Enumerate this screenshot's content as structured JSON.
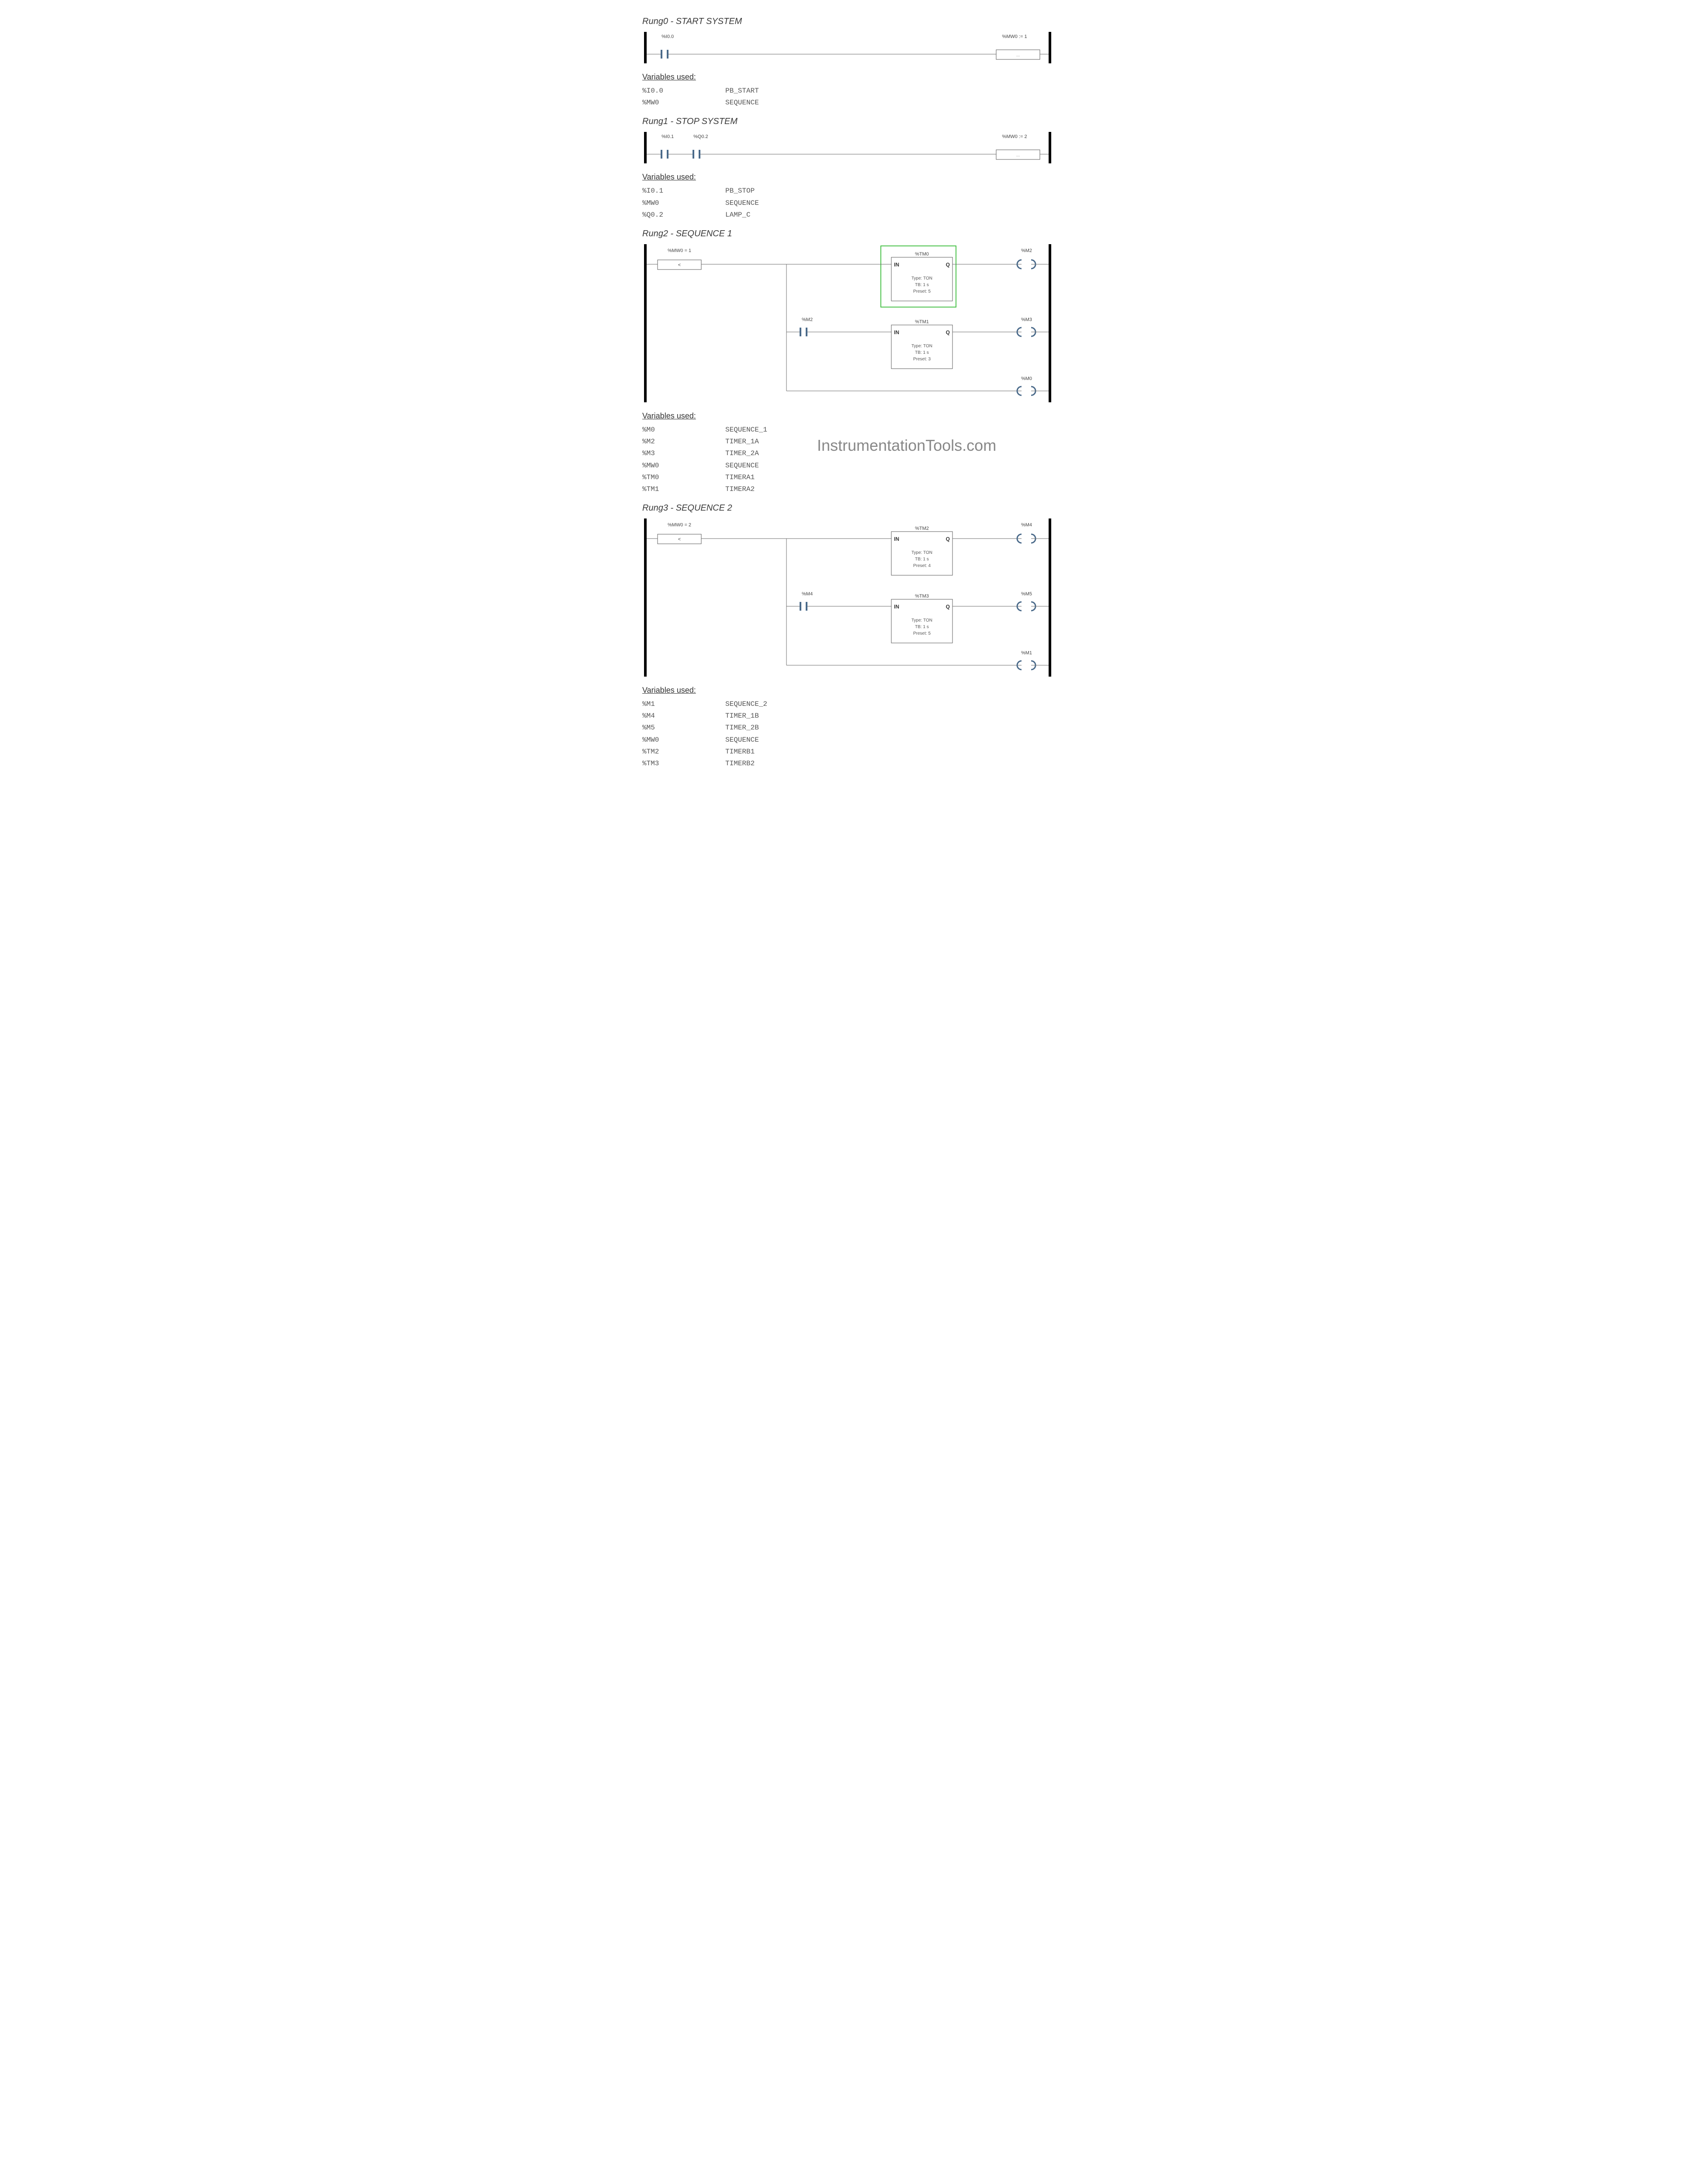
{
  "rungs": [
    {
      "title": "Rung0 - START SYSTEM",
      "contact1_label": "%I0.0",
      "op_label": "%MW0 := 1",
      "op_symbol": "...",
      "vars": [
        {
          "addr": "%I0.0",
          "name": "PB_START"
        },
        {
          "addr": "%MW0",
          "name": "SEQUENCE"
        }
      ]
    },
    {
      "title": "Rung1 - STOP SYSTEM",
      "contact1_label": "%I0.1",
      "contact2_label": "%Q0.2",
      "op_label": "%MW0 := 2",
      "op_symbol": "...",
      "vars": [
        {
          "addr": "%I0.1",
          "name": "PB_STOP"
        },
        {
          "addr": "%MW0",
          "name": "SEQUENCE"
        },
        {
          "addr": "%Q0.2",
          "name": "LAMP_C"
        }
      ]
    },
    {
      "title": "Rung2 - SEQUENCE 1",
      "compare_label": "%MW0 = 1",
      "compare_symbol": "<",
      "timer1": {
        "addr": "%TM0",
        "type": "Type: TON",
        "tb": "TB: 1 s",
        "preset": "Preset: 5",
        "in": "IN",
        "q": "Q"
      },
      "coil1_label": "%M2",
      "contact_b_label": "%M2",
      "timer2": {
        "addr": "%TM1",
        "type": "Type: TON",
        "tb": "TB: 1 s",
        "preset": "Preset: 3",
        "in": "IN",
        "q": "Q"
      },
      "coil2_label": "%M3",
      "coil3_label": "%M0",
      "vars": [
        {
          "addr": "%M0",
          "name": "SEQUENCE_1"
        },
        {
          "addr": "%M2",
          "name": "TIMER_1A"
        },
        {
          "addr": "%M3",
          "name": "TIMER_2A"
        },
        {
          "addr": "%MW0",
          "name": "SEQUENCE"
        },
        {
          "addr": "%TM0",
          "name": "TIMERA1"
        },
        {
          "addr": "%TM1",
          "name": "TIMERA2"
        }
      ]
    },
    {
      "title": "Rung3 - SEQUENCE 2",
      "compare_label": "%MW0 = 2",
      "compare_symbol": "<",
      "timer1": {
        "addr": "%TM2",
        "type": "Type: TON",
        "tb": "TB: 1 s",
        "preset": "Preset: 4",
        "in": "IN",
        "q": "Q"
      },
      "coil1_label": "%M4",
      "contact_b_label": "%M4",
      "timer2": {
        "addr": "%TM3",
        "type": "Type: TON",
        "tb": "TB: 1 s",
        "preset": "Preset: 5",
        "in": "IN",
        "q": "Q"
      },
      "coil2_label": "%M5",
      "coil3_label": "%M1",
      "vars": [
        {
          "addr": "%M1",
          "name": "SEQUENCE_2"
        },
        {
          "addr": "%M4",
          "name": "TIMER_1B"
        },
        {
          "addr": "%M5",
          "name": "TIMER_2B"
        },
        {
          "addr": "%MW0",
          "name": "SEQUENCE"
        },
        {
          "addr": "%TM2",
          "name": "TIMERB1"
        },
        {
          "addr": "%TM3",
          "name": "TIMERB2"
        }
      ]
    }
  ],
  "vars_heading": "Variables used:",
  "watermark": "InstrumentationTools.com"
}
